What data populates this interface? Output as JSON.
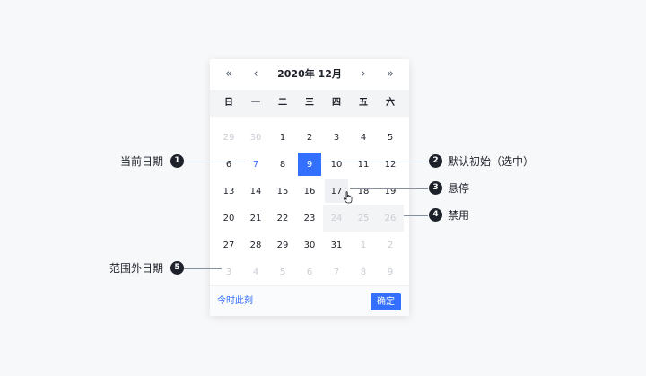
{
  "calendar": {
    "title": "2020年 12月",
    "nav": {
      "prev_year": "«",
      "prev_month": "‹",
      "next_month": "›",
      "next_year": "»"
    },
    "weekdays": [
      "日",
      "一",
      "二",
      "三",
      "四",
      "五",
      "六"
    ],
    "weeks": [
      [
        {
          "label": "29",
          "state": "other"
        },
        {
          "label": "30",
          "state": "other"
        },
        {
          "label": "1",
          "state": "normal"
        },
        {
          "label": "2",
          "state": "normal"
        },
        {
          "label": "3",
          "state": "normal"
        },
        {
          "label": "4",
          "state": "normal"
        },
        {
          "label": "5",
          "state": "normal"
        }
      ],
      [
        {
          "label": "6",
          "state": "normal"
        },
        {
          "label": "7",
          "state": "today"
        },
        {
          "label": "8",
          "state": "normal"
        },
        {
          "label": "9",
          "state": "selected"
        },
        {
          "label": "10",
          "state": "normal"
        },
        {
          "label": "11",
          "state": "normal"
        },
        {
          "label": "12",
          "state": "normal"
        }
      ],
      [
        {
          "label": "13",
          "state": "normal"
        },
        {
          "label": "14",
          "state": "normal"
        },
        {
          "label": "15",
          "state": "normal"
        },
        {
          "label": "16",
          "state": "normal"
        },
        {
          "label": "17",
          "state": "hover"
        },
        {
          "label": "18",
          "state": "normal"
        },
        {
          "label": "19",
          "state": "normal"
        }
      ],
      [
        {
          "label": "20",
          "state": "normal"
        },
        {
          "label": "21",
          "state": "normal"
        },
        {
          "label": "22",
          "state": "normal"
        },
        {
          "label": "23",
          "state": "normal"
        },
        {
          "label": "24",
          "state": "disabled"
        },
        {
          "label": "25",
          "state": "disabled"
        },
        {
          "label": "26",
          "state": "disabled"
        }
      ],
      [
        {
          "label": "27",
          "state": "normal"
        },
        {
          "label": "28",
          "state": "normal"
        },
        {
          "label": "29",
          "state": "normal"
        },
        {
          "label": "30",
          "state": "normal"
        },
        {
          "label": "31",
          "state": "normal"
        },
        {
          "label": "1",
          "state": "other"
        },
        {
          "label": "2",
          "state": "other"
        }
      ],
      [
        {
          "label": "3",
          "state": "other"
        },
        {
          "label": "4",
          "state": "other"
        },
        {
          "label": "5",
          "state": "other"
        },
        {
          "label": "6",
          "state": "other"
        },
        {
          "label": "7",
          "state": "other"
        },
        {
          "label": "8",
          "state": "other"
        },
        {
          "label": "9",
          "state": "other"
        }
      ]
    ],
    "footer": {
      "now_label": "今时此刻",
      "confirm_label": "确定"
    }
  },
  "callouts": {
    "c1": {
      "num": "1",
      "label": "当前日期"
    },
    "c2": {
      "num": "2",
      "label": "默认初始（选中）"
    },
    "c3": {
      "num": "3",
      "label": "悬停"
    },
    "c4": {
      "num": "4",
      "label": "禁用"
    },
    "c5": {
      "num": "5",
      "label": "范围外日期"
    }
  },
  "colors": {
    "accent": "#3370ff",
    "badge": "#1d2129",
    "muted_text": "#c9cdd4",
    "disabled_bg": "#f3f4f6"
  },
  "icons": {
    "cursor": "hand-pointer-icon"
  }
}
